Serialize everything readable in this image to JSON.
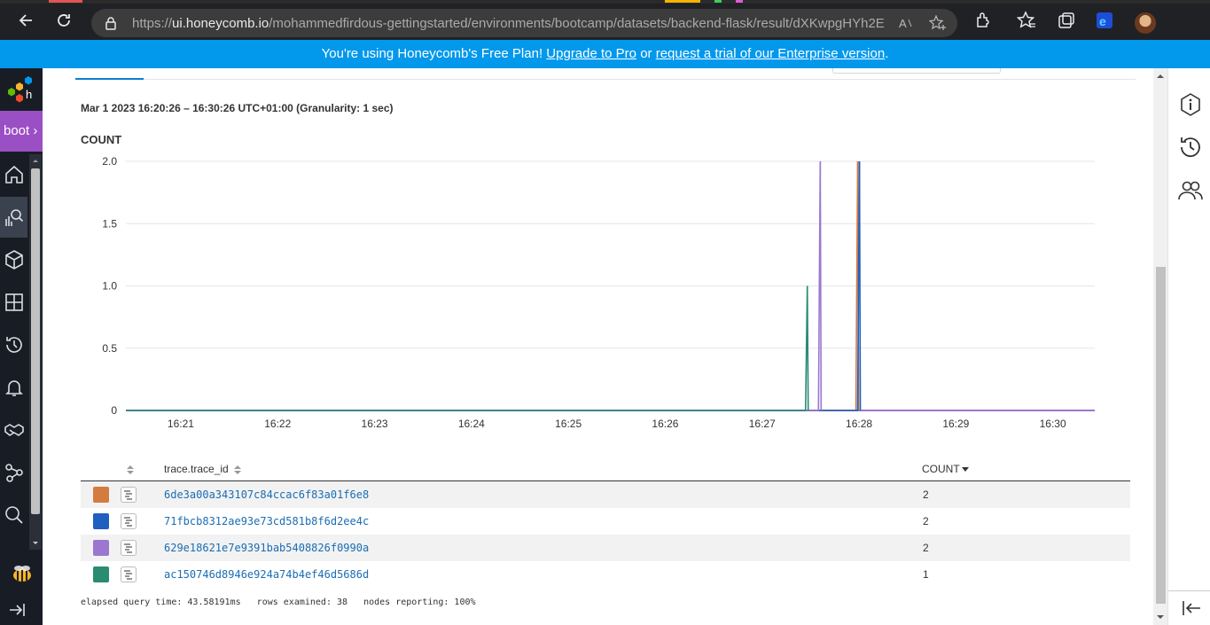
{
  "browser": {
    "url_prefix": "https://",
    "url_host": "ui.honeycomb.io",
    "url_path": "/mohammedfirdous-gettingstarted/environments/bootcamp/datasets/backend-flask/result/dXKwpgHYh2E"
  },
  "banner": {
    "text_before": "You're using Honeycomb's Free Plan! ",
    "upgrade_link": "Upgrade to Pro",
    "text_middle": " or ",
    "trial_link": "request a trial of our Enterprise version",
    "text_after": "."
  },
  "sidebar": {
    "environment_label": "boot",
    "chevron": "›",
    "items": [
      "home-icon",
      "query-icon",
      "datasets-icon",
      "boards-icon",
      "history-icon",
      "triggers-icon",
      "handshake-icon",
      "service-map-icon",
      "search-icon"
    ]
  },
  "query": {
    "time_range": "Mar 1 2023 16:20:26 – 16:30:26 UTC+01:00 (Granularity: 1 sec)"
  },
  "chart_data": {
    "type": "line",
    "title": "COUNT",
    "xlabel": "",
    "ylabel": "",
    "ylim": [
      0,
      2
    ],
    "y_ticks": [
      "2.0",
      "1.5",
      "1.0",
      "0.5",
      "0"
    ],
    "x_ticks": [
      "16:21",
      "16:22",
      "16:23",
      "16:24",
      "16:25",
      "16:26",
      "16:27",
      "16:28",
      "16:29",
      "16:30"
    ],
    "series": [
      {
        "name": "6de3a00a343107c84ccac6f83a01f6e8",
        "color": "#d47b40",
        "spike_time": "16:28",
        "value": 2
      },
      {
        "name": "71fbcb8312ae93e73cd581b8f6d2ee4c",
        "color": "#1f5fbf",
        "spike_time": "16:28",
        "value": 2
      },
      {
        "name": "629e18621e7e9391bab5408826f0990a",
        "color": "#9b77cf",
        "spike_time": "16:27:36",
        "value": 2
      },
      {
        "name": "ac150746d8946e924a74b4ef46d5686d",
        "color": "#2a8b73",
        "spike_time": "16:27:28",
        "value": 1
      }
    ]
  },
  "results": {
    "columns": [
      "trace.trace_id",
      "COUNT"
    ],
    "rows": [
      {
        "trace_id": "6de3a00a343107c84ccac6f83a01f6e8",
        "count": "2",
        "color": "#d47b40"
      },
      {
        "trace_id": "71fbcb8312ae93e73cd581b8f6d2ee4c",
        "count": "2",
        "color": "#1f5fbf"
      },
      {
        "trace_id": "629e18621e7e9391bab5408826f0990a",
        "count": "2",
        "color": "#9b77cf"
      },
      {
        "trace_id": "ac150746d8946e924a74b4ef46d5686d",
        "count": "1",
        "color": "#2a8b73"
      }
    ],
    "stats": "elapsed query time: 43.58191ms   rows examined: 38   nodes reporting: 100%"
  },
  "right_rail": [
    "info-icon",
    "history-icon",
    "users-icon",
    "collapse-icon"
  ]
}
